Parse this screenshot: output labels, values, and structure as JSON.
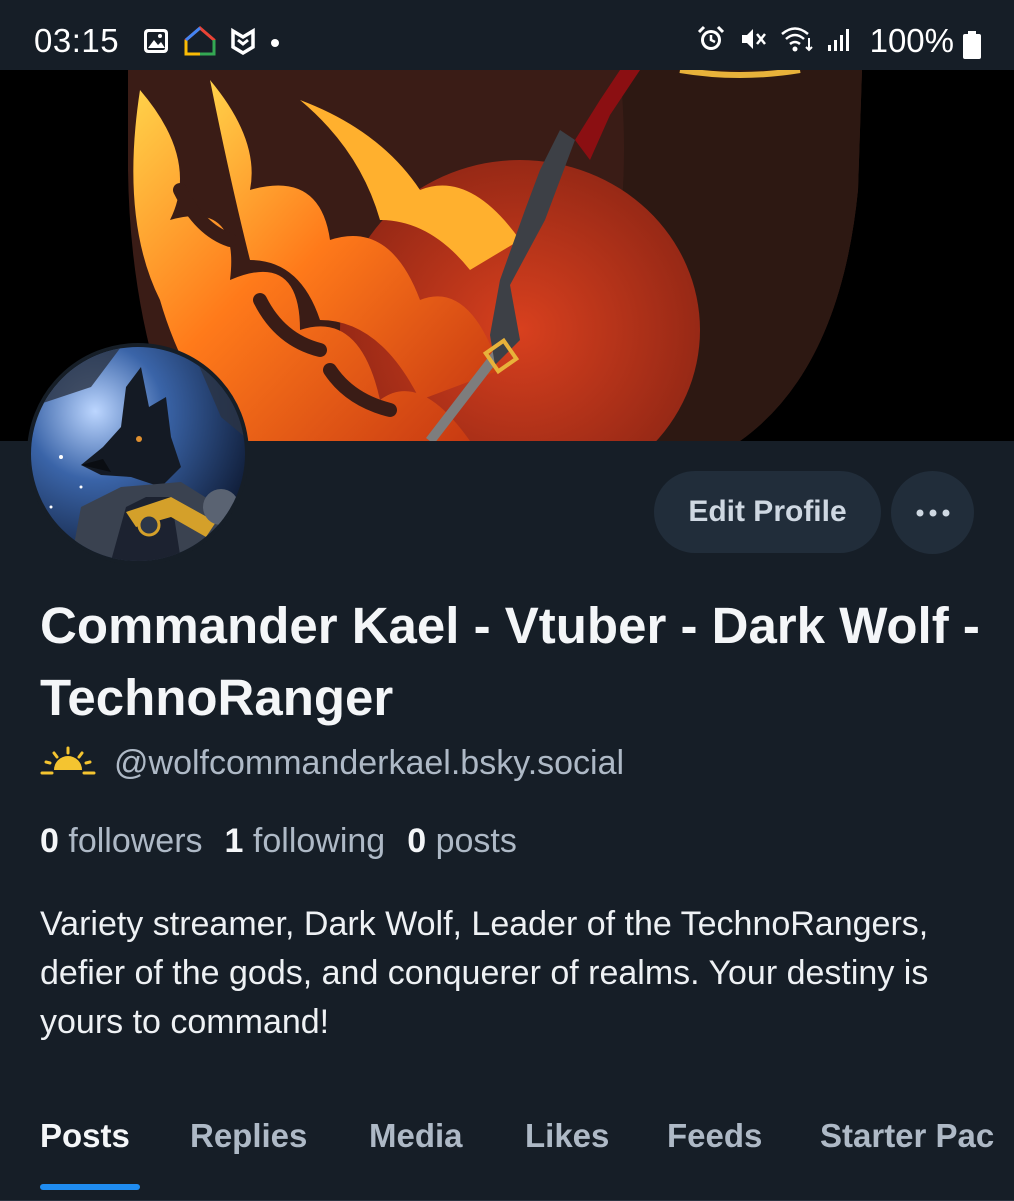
{
  "status_bar": {
    "time": "03:15",
    "battery": "100%",
    "left_icons": [
      "gallery-icon",
      "google-home-icon",
      "malwarebytes-icon",
      "dot-icon"
    ],
    "right_icons": [
      "alarm-icon",
      "mute-icon",
      "wifi-icon",
      "signal-icon",
      "battery-icon"
    ]
  },
  "profile": {
    "edit_label": "Edit Profile",
    "more_label": "•••",
    "display_name": "Commander Kael - Vtuber - Dark Wolf - TechnoRanger",
    "handle_icon": "sunrise-icon",
    "handle": "@wolfcommanderkael.bsky.social",
    "stats": {
      "followers_count": "0",
      "followers_label": "followers",
      "following_count": "1",
      "following_label": "following",
      "posts_count": "0",
      "posts_label": "posts"
    },
    "bio": "Variety streamer, Dark Wolf, Leader of the TechnoRangers, defier of the gods, and conquerer of realms. Your destiny is yours to command!"
  },
  "tabs": [
    {
      "label": "Posts",
      "active": true
    },
    {
      "label": "Replies",
      "active": false
    },
    {
      "label": "Media",
      "active": false
    },
    {
      "label": "Likes",
      "active": false
    },
    {
      "label": "Feeds",
      "active": false
    },
    {
      "label": "Starter Pac",
      "active": false
    }
  ],
  "colors": {
    "background": "#161e27",
    "button_bg": "#212d3a",
    "accent": "#1f8cf0",
    "muted_text": "#aeb9c6"
  }
}
